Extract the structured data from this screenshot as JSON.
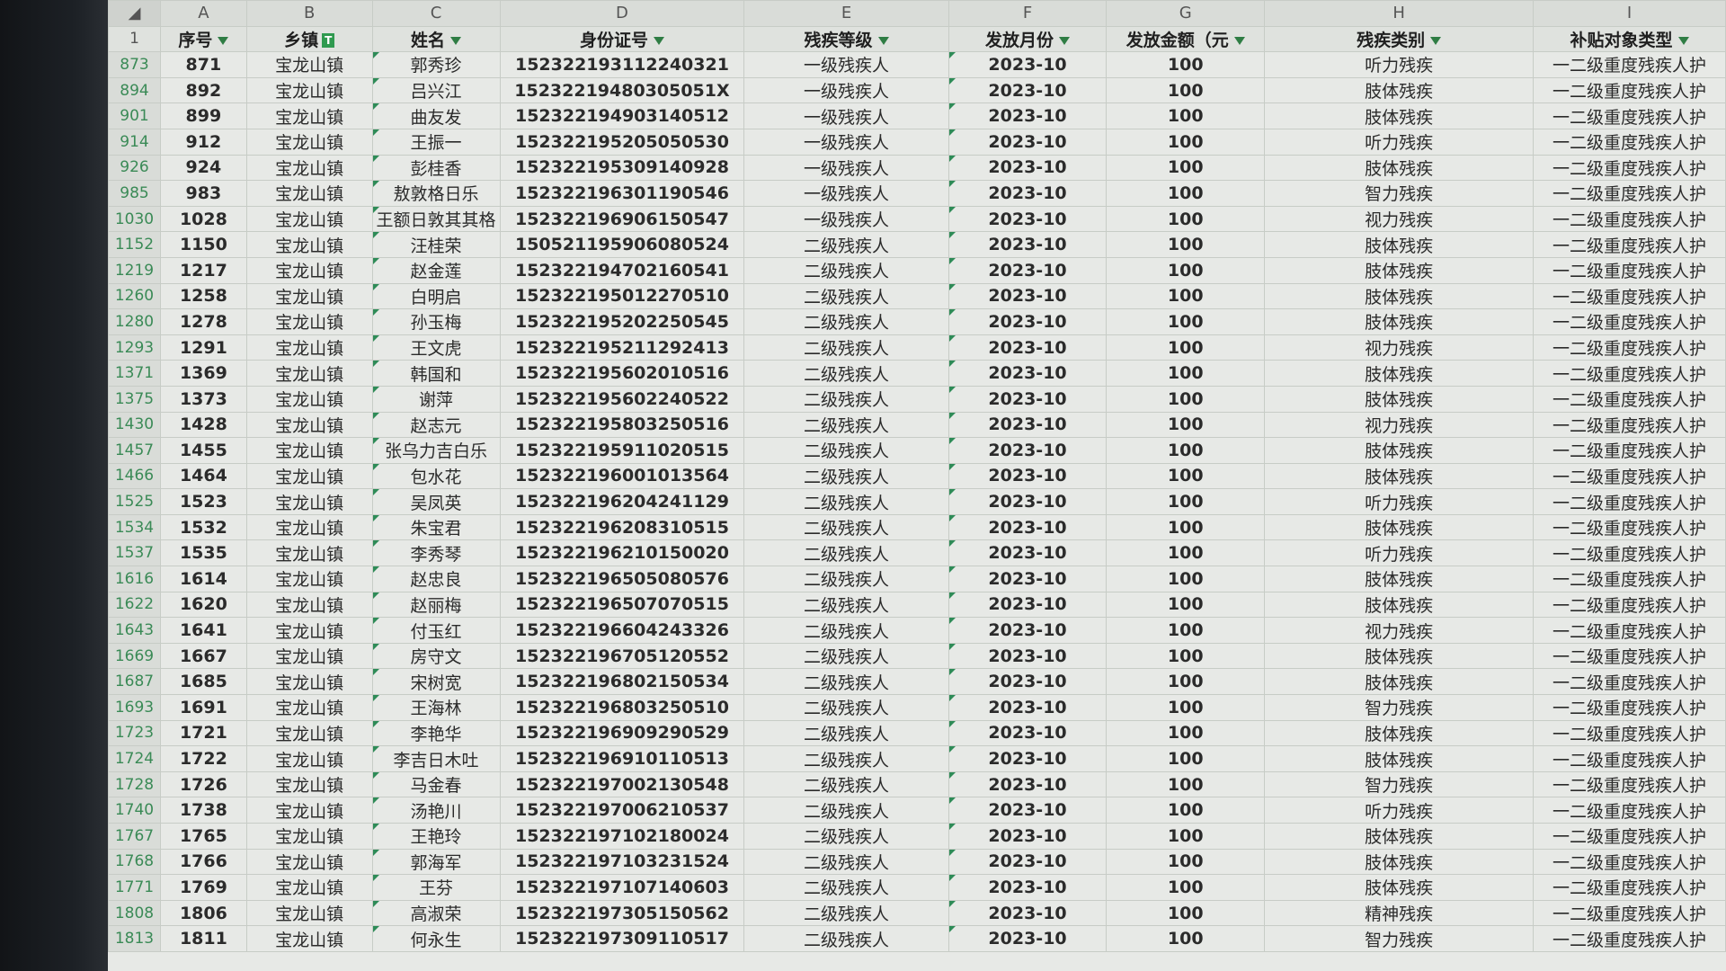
{
  "spreadsheet": {
    "column_letters": [
      "A",
      "B",
      "C",
      "D",
      "E",
      "F",
      "G",
      "H",
      "I"
    ],
    "header_row_number": "1",
    "headers": [
      "序号",
      "乡镇",
      "姓名",
      "身份证号",
      "残疾等级",
      "发放月份",
      "发放金额（元",
      "残疾类别",
      "补贴对象类型"
    ],
    "rows": [
      {
        "rownum": "873",
        "no": "871",
        "town": "宝龙山镇",
        "name": "郭秀珍",
        "id": "152322193112240321",
        "level": "一级残疾人",
        "month": "2023-10",
        "amount": "100",
        "category": "听力残疾",
        "type": "一二级重度残疾人护"
      },
      {
        "rownum": "894",
        "no": "892",
        "town": "宝龙山镇",
        "name": "吕兴江",
        "id": "15232219480305051X",
        "level": "一级残疾人",
        "month": "2023-10",
        "amount": "100",
        "category": "肢体残疾",
        "type": "一二级重度残疾人护"
      },
      {
        "rownum": "901",
        "no": "899",
        "town": "宝龙山镇",
        "name": "曲友发",
        "id": "152322194903140512",
        "level": "一级残疾人",
        "month": "2023-10",
        "amount": "100",
        "category": "肢体残疾",
        "type": "一二级重度残疾人护"
      },
      {
        "rownum": "914",
        "no": "912",
        "town": "宝龙山镇",
        "name": "王振一",
        "id": "152322195205050530",
        "level": "一级残疾人",
        "month": "2023-10",
        "amount": "100",
        "category": "听力残疾",
        "type": "一二级重度残疾人护"
      },
      {
        "rownum": "926",
        "no": "924",
        "town": "宝龙山镇",
        "name": "彭桂香",
        "id": "152322195309140928",
        "level": "一级残疾人",
        "month": "2023-10",
        "amount": "100",
        "category": "肢体残疾",
        "type": "一二级重度残疾人护"
      },
      {
        "rownum": "985",
        "no": "983",
        "town": "宝龙山镇",
        "name": "敖敦格日乐",
        "id": "152322196301190546",
        "level": "一级残疾人",
        "month": "2023-10",
        "amount": "100",
        "category": "智力残疾",
        "type": "一二级重度残疾人护"
      },
      {
        "rownum": "1030",
        "no": "1028",
        "town": "宝龙山镇",
        "name": "王额日敦其其格",
        "id": "152322196906150547",
        "level": "一级残疾人",
        "month": "2023-10",
        "amount": "100",
        "category": "视力残疾",
        "type": "一二级重度残疾人护"
      },
      {
        "rownum": "1152",
        "no": "1150",
        "town": "宝龙山镇",
        "name": "汪桂荣",
        "id": "150521195906080524",
        "level": "二级残疾人",
        "month": "2023-10",
        "amount": "100",
        "category": "肢体残疾",
        "type": "一二级重度残疾人护"
      },
      {
        "rownum": "1219",
        "no": "1217",
        "town": "宝龙山镇",
        "name": "赵金莲",
        "id": "152322194702160541",
        "level": "二级残疾人",
        "month": "2023-10",
        "amount": "100",
        "category": "肢体残疾",
        "type": "一二级重度残疾人护"
      },
      {
        "rownum": "1260",
        "no": "1258",
        "town": "宝龙山镇",
        "name": "白明启",
        "id": "152322195012270510",
        "level": "二级残疾人",
        "month": "2023-10",
        "amount": "100",
        "category": "肢体残疾",
        "type": "一二级重度残疾人护"
      },
      {
        "rownum": "1280",
        "no": "1278",
        "town": "宝龙山镇",
        "name": "孙玉梅",
        "id": "152322195202250545",
        "level": "二级残疾人",
        "month": "2023-10",
        "amount": "100",
        "category": "肢体残疾",
        "type": "一二级重度残疾人护"
      },
      {
        "rownum": "1293",
        "no": "1291",
        "town": "宝龙山镇",
        "name": "王文虎",
        "id": "152322195211292413",
        "level": "二级残疾人",
        "month": "2023-10",
        "amount": "100",
        "category": "视力残疾",
        "type": "一二级重度残疾人护"
      },
      {
        "rownum": "1371",
        "no": "1369",
        "town": "宝龙山镇",
        "name": "韩国和",
        "id": "152322195602010516",
        "level": "二级残疾人",
        "month": "2023-10",
        "amount": "100",
        "category": "肢体残疾",
        "type": "一二级重度残疾人护"
      },
      {
        "rownum": "1375",
        "no": "1373",
        "town": "宝龙山镇",
        "name": "谢萍",
        "id": "152322195602240522",
        "level": "二级残疾人",
        "month": "2023-10",
        "amount": "100",
        "category": "肢体残疾",
        "type": "一二级重度残疾人护"
      },
      {
        "rownum": "1430",
        "no": "1428",
        "town": "宝龙山镇",
        "name": "赵志元",
        "id": "152322195803250516",
        "level": "二级残疾人",
        "month": "2023-10",
        "amount": "100",
        "category": "视力残疾",
        "type": "一二级重度残疾人护"
      },
      {
        "rownum": "1457",
        "no": "1455",
        "town": "宝龙山镇",
        "name": "张乌力吉白乐",
        "id": "152322195911020515",
        "level": "二级残疾人",
        "month": "2023-10",
        "amount": "100",
        "category": "肢体残疾",
        "type": "一二级重度残疾人护"
      },
      {
        "rownum": "1466",
        "no": "1464",
        "town": "宝龙山镇",
        "name": "包水花",
        "id": "152322196001013564",
        "level": "二级残疾人",
        "month": "2023-10",
        "amount": "100",
        "category": "肢体残疾",
        "type": "一二级重度残疾人护"
      },
      {
        "rownum": "1525",
        "no": "1523",
        "town": "宝龙山镇",
        "name": "吴凤英",
        "id": "152322196204241129",
        "level": "二级残疾人",
        "month": "2023-10",
        "amount": "100",
        "category": "听力残疾",
        "type": "一二级重度残疾人护"
      },
      {
        "rownum": "1534",
        "no": "1532",
        "town": "宝龙山镇",
        "name": "朱宝君",
        "id": "152322196208310515",
        "level": "二级残疾人",
        "month": "2023-10",
        "amount": "100",
        "category": "肢体残疾",
        "type": "一二级重度残疾人护"
      },
      {
        "rownum": "1537",
        "no": "1535",
        "town": "宝龙山镇",
        "name": "李秀琴",
        "id": "152322196210150020",
        "level": "二级残疾人",
        "month": "2023-10",
        "amount": "100",
        "category": "听力残疾",
        "type": "一二级重度残疾人护"
      },
      {
        "rownum": "1616",
        "no": "1614",
        "town": "宝龙山镇",
        "name": "赵忠良",
        "id": "152322196505080576",
        "level": "二级残疾人",
        "month": "2023-10",
        "amount": "100",
        "category": "肢体残疾",
        "type": "一二级重度残疾人护"
      },
      {
        "rownum": "1622",
        "no": "1620",
        "town": "宝龙山镇",
        "name": "赵丽梅",
        "id": "152322196507070515",
        "level": "二级残疾人",
        "month": "2023-10",
        "amount": "100",
        "category": "肢体残疾",
        "type": "一二级重度残疾人护"
      },
      {
        "rownum": "1643",
        "no": "1641",
        "town": "宝龙山镇",
        "name": "付玉红",
        "id": "152322196604243326",
        "level": "二级残疾人",
        "month": "2023-10",
        "amount": "100",
        "category": "视力残疾",
        "type": "一二级重度残疾人护"
      },
      {
        "rownum": "1669",
        "no": "1667",
        "town": "宝龙山镇",
        "name": "房守文",
        "id": "152322196705120552",
        "level": "二级残疾人",
        "month": "2023-10",
        "amount": "100",
        "category": "肢体残疾",
        "type": "一二级重度残疾人护"
      },
      {
        "rownum": "1687",
        "no": "1685",
        "town": "宝龙山镇",
        "name": "宋树宽",
        "id": "152322196802150534",
        "level": "二级残疾人",
        "month": "2023-10",
        "amount": "100",
        "category": "肢体残疾",
        "type": "一二级重度残疾人护"
      },
      {
        "rownum": "1693",
        "no": "1691",
        "town": "宝龙山镇",
        "name": "王海林",
        "id": "152322196803250510",
        "level": "二级残疾人",
        "month": "2023-10",
        "amount": "100",
        "category": "智力残疾",
        "type": "一二级重度残疾人护"
      },
      {
        "rownum": "1723",
        "no": "1721",
        "town": "宝龙山镇",
        "name": "李艳华",
        "id": "152322196909290529",
        "level": "二级残疾人",
        "month": "2023-10",
        "amount": "100",
        "category": "肢体残疾",
        "type": "一二级重度残疾人护"
      },
      {
        "rownum": "1724",
        "no": "1722",
        "town": "宝龙山镇",
        "name": "李吉日木吐",
        "id": "152322196910110513",
        "level": "二级残疾人",
        "month": "2023-10",
        "amount": "100",
        "category": "肢体残疾",
        "type": "一二级重度残疾人护"
      },
      {
        "rownum": "1728",
        "no": "1726",
        "town": "宝龙山镇",
        "name": "马金春",
        "id": "152322197002130548",
        "level": "二级残疾人",
        "month": "2023-10",
        "amount": "100",
        "category": "智力残疾",
        "type": "一二级重度残疾人护"
      },
      {
        "rownum": "1740",
        "no": "1738",
        "town": "宝龙山镇",
        "name": "汤艳川",
        "id": "152322197006210537",
        "level": "二级残疾人",
        "month": "2023-10",
        "amount": "100",
        "category": "听力残疾",
        "type": "一二级重度残疾人护"
      },
      {
        "rownum": "1767",
        "no": "1765",
        "town": "宝龙山镇",
        "name": "王艳玲",
        "id": "152322197102180024",
        "level": "二级残疾人",
        "month": "2023-10",
        "amount": "100",
        "category": "肢体残疾",
        "type": "一二级重度残疾人护"
      },
      {
        "rownum": "1768",
        "no": "1766",
        "town": "宝龙山镇",
        "name": "郭海军",
        "id": "152322197103231524",
        "level": "二级残疾人",
        "month": "2023-10",
        "amount": "100",
        "category": "肢体残疾",
        "type": "一二级重度残疾人护"
      },
      {
        "rownum": "1771",
        "no": "1769",
        "town": "宝龙山镇",
        "name": "王芬",
        "id": "152322197107140603",
        "level": "二级残疾人",
        "month": "2023-10",
        "amount": "100",
        "category": "肢体残疾",
        "type": "一二级重度残疾人护"
      },
      {
        "rownum": "1808",
        "no": "1806",
        "town": "宝龙山镇",
        "name": "高淑荣",
        "id": "152322197305150562",
        "level": "二级残疾人",
        "month": "2023-10",
        "amount": "100",
        "category": "精神残疾",
        "type": "一二级重度残疾人护"
      },
      {
        "rownum": "1813",
        "no": "1811",
        "town": "宝龙山镇",
        "name": "何永生",
        "id": "152322197309110517",
        "level": "二级残疾人",
        "month": "2023-10",
        "amount": "100",
        "category": "智力残疾",
        "type": "一二级重度残疾人护"
      }
    ]
  },
  "colors": {
    "accent_green": "#2f7d44",
    "row_number_green": "#3a8a56"
  }
}
